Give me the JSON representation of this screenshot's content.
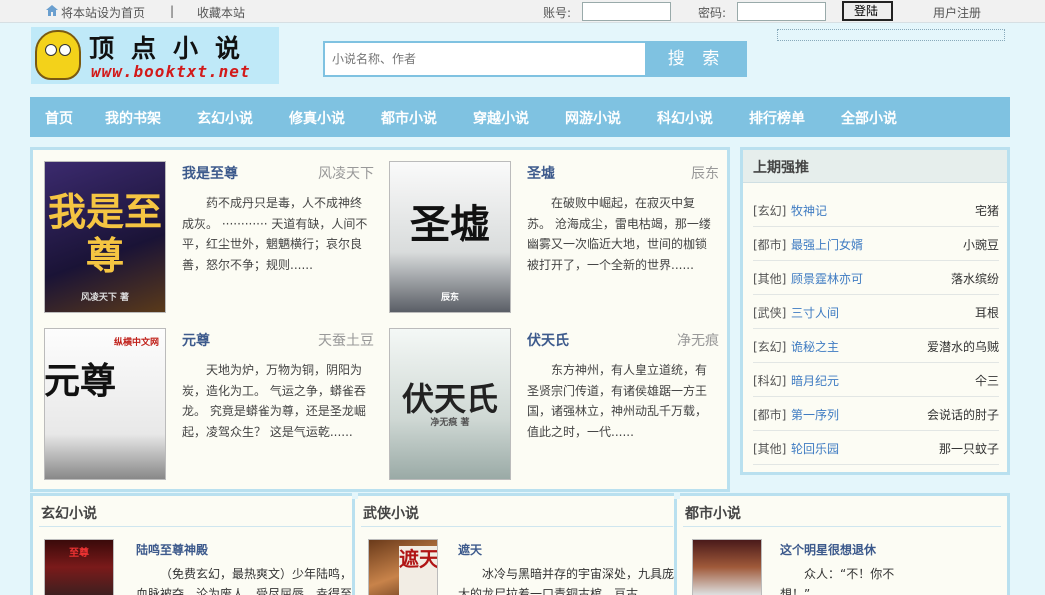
{
  "topbar": {
    "set_home": "将本站设为首页",
    "separator": "|",
    "bookmark": "收藏本站",
    "account_label": "账号:",
    "password_label": "密码:",
    "login_button": "登陆",
    "register": "用户注册"
  },
  "logo": {
    "name": "顶点小说",
    "url": "www.booktxt.net"
  },
  "search": {
    "placeholder": "小说名称、作者",
    "button": "搜 索"
  },
  "nav": [
    "首页",
    "我的书架",
    "玄幻小说",
    "修真小说",
    "都市小说",
    "穿越小说",
    "网游小说",
    "科幻小说",
    "排行榜单",
    "全部小说"
  ],
  "featured": [
    {
      "title": "我是至尊",
      "author": "风凌天下",
      "desc": "药不成丹只是毒，人不成神终成灰。 ············ 天道有缺，人间不平，红尘世外，魍魉横行；哀尔良善，怒尔不争；规则......",
      "cover_text": "我是至尊",
      "cover_sub": "风凌天下 著"
    },
    {
      "title": "圣墟",
      "author": "辰东",
      "desc": "在破败中崛起，在寂灭中复苏。 沧海成尘，雷电枯竭，那一缕幽雾又一次临近大地，世间的枷锁被打开了，一个全新的世界......",
      "cover_text": "圣墟",
      "cover_sub": "辰东"
    },
    {
      "title": "元尊",
      "author": "天蚕土豆",
      "desc": "天地为炉，万物为铜，阴阳为炭，造化为工。 气运之争，蟒雀吞龙。 究竟是蟒雀为尊，还是圣龙崛起，凌驾众生？ 这是气运乾......",
      "cover_text": "元尊",
      "cover_sub": "纵横中文网"
    },
    {
      "title": "伏天氏",
      "author": "净无痕",
      "desc": "东方神州，有人皇立道统，有圣贤宗门传道，有诸侯雄踞一方王国，诸强林立，神州动乱千万载，值此之时，一代......",
      "cover_text": "伏天氏",
      "cover_sub": "净无痕 著"
    }
  ],
  "recommend": {
    "title": "上期强推",
    "items": [
      {
        "cat": "[玄幻]",
        "book": "牧神记",
        "author": "宅猪"
      },
      {
        "cat": "[都市]",
        "book": "最强上门女婿",
        "author": "小豌豆"
      },
      {
        "cat": "[其他]",
        "book": "顾景霆林亦可",
        "author": "落水缤纷"
      },
      {
        "cat": "[武侠]",
        "book": "三寸人间",
        "author": "耳根"
      },
      {
        "cat": "[玄幻]",
        "book": "诡秘之主",
        "author": "爱潜水的乌贼"
      },
      {
        "cat": "[科幻]",
        "book": "暗月纪元",
        "author": "仐三"
      },
      {
        "cat": "[都市]",
        "book": "第一序列",
        "author": "会说话的肘子"
      },
      {
        "cat": "[其他]",
        "book": "轮回乐园",
        "author": "那一只蚊子"
      }
    ]
  },
  "categories": [
    {
      "title": "玄幻小说",
      "book": "陆鸣至尊神殿",
      "desc": "（免费玄幻，最热爽文）少年陆鸣，血脉被夺，沦为废人，受尽屈辱。幸得至尊神",
      "cover_text": "至尊"
    },
    {
      "title": "武侠小说",
      "book": "遮天",
      "desc": "冰冷与黑暗并存的宇宙深处，九具庞大的龙尸拉着一口青铜古棺，亘古",
      "cover_text": "遮天"
    },
    {
      "title": "都市小说",
      "book": "这个明星很想退休",
      "desc": "众人：“不！你不想！”",
      "cover_text": ""
    }
  ],
  "colors": {
    "nav": "#7fc2e1",
    "panel_border": "#b9e0ef",
    "link": "#3e7bc2",
    "title": "#3d5a8c",
    "logo_url": "#d21a1a",
    "background": "#e4f6fb"
  }
}
